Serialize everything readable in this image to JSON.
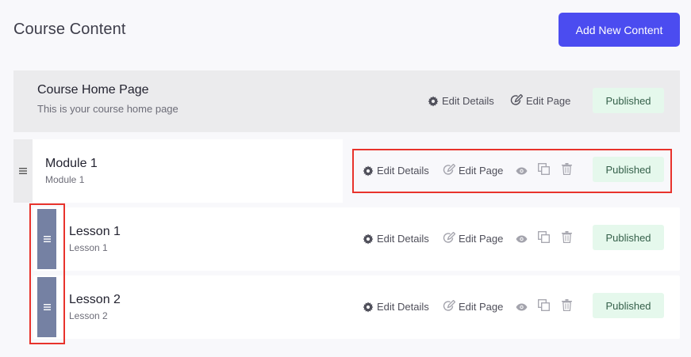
{
  "header": {
    "title": "Course Content",
    "add_button_label": "Add New Content"
  },
  "home": {
    "title": "Course Home Page",
    "subtitle": "This is your course home page",
    "edit_details_label": "Edit Details",
    "edit_page_label": "Edit Page",
    "status": "Published"
  },
  "module": {
    "title": "Module 1",
    "subtitle": "Module 1",
    "edit_details_label": "Edit Details",
    "edit_page_label": "Edit Page",
    "status": "Published"
  },
  "lessons": [
    {
      "title": "Lesson 1",
      "subtitle": "Lesson 1",
      "edit_details_label": "Edit Details",
      "edit_page_label": "Edit Page",
      "status": "Published"
    },
    {
      "title": "Lesson 2",
      "subtitle": "Lesson 2",
      "edit_details_label": "Edit Details",
      "edit_page_label": "Edit Page",
      "status": "Published"
    }
  ],
  "colors": {
    "accent": "#4b4cf0",
    "highlight": "#e8332c",
    "published_bg": "#e5f8ec",
    "drag_handle": "#7581a3"
  },
  "icons": [
    "drag-handle-icon",
    "gear-icon",
    "edit-page-icon",
    "eye-icon",
    "duplicate-icon",
    "trash-icon"
  ]
}
